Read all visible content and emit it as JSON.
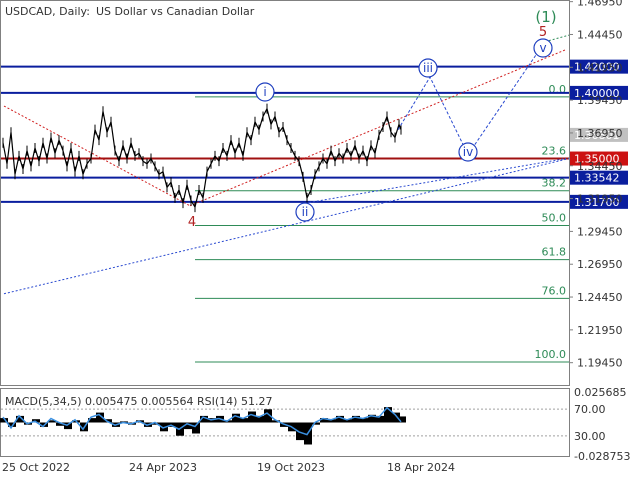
{
  "header": {
    "symbol": "USDCAD, Daily:",
    "description": "US Dollar vs Canadian Dollar"
  },
  "indicator_label": "MACD(5,34,5) 0.005475 0.005564 RSI(14) 51.27",
  "colors": {
    "price": "#000000",
    "support_resistance": "#0a1e9e",
    "pivot_line": "#a01010",
    "fib_line": "#2e8b57",
    "fib_text": "#2e8b57",
    "wave_circle": "#1f3fbf",
    "dotted_blue": "#2a4ad0",
    "dotted_red": "#d02020",
    "level_box_blue": "#0a1e9e",
    "level_box_red": "#cc1111",
    "current_box": "#c0c0c0",
    "rsi": "#3a8fe0",
    "macd": "#000000"
  },
  "chart_data": [
    {
      "type": "line",
      "title": "USDCAD, Daily: US Dollar vs Canadian Dollar",
      "x_ticks": [
        "25 Oct 2022",
        "24 Apr 2023",
        "19 Oct 2023",
        "18 Apr 2024"
      ],
      "y_ticks": [
        "1.46950",
        "1.44450",
        "1.41950",
        "1.39450",
        "1.36950",
        "1.34450",
        "1.31950",
        "1.29450",
        "1.26950",
        "1.24450",
        "1.21950",
        "1.19450"
      ],
      "ylim": [
        1.1775,
        1.47
      ],
      "price_path": [
        [
          0,
          1.362
        ],
        [
          4,
          1.346
        ],
        [
          8,
          1.37
        ],
        [
          12,
          1.338
        ],
        [
          16,
          1.352
        ],
        [
          20,
          1.342
        ],
        [
          24,
          1.356
        ],
        [
          28,
          1.344
        ],
        [
          32,
          1.358
        ],
        [
          36,
          1.348
        ],
        [
          40,
          1.362
        ],
        [
          44,
          1.35
        ],
        [
          48,
          1.366
        ],
        [
          52,
          1.354
        ],
        [
          56,
          1.364
        ],
        [
          60,
          1.356
        ],
        [
          64,
          1.344
        ],
        [
          68,
          1.358
        ],
        [
          72,
          1.34
        ],
        [
          76,
          1.352
        ],
        [
          80,
          1.338
        ],
        [
          84,
          1.346
        ],
        [
          88,
          1.35
        ],
        [
          92,
          1.372
        ],
        [
          96,
          1.364
        ],
        [
          100,
          1.386
        ],
        [
          104,
          1.37
        ],
        [
          108,
          1.378
        ],
        [
          112,
          1.356
        ],
        [
          116,
          1.348
        ],
        [
          120,
          1.36
        ],
        [
          124,
          1.35
        ],
        [
          128,
          1.362
        ],
        [
          132,
          1.352
        ],
        [
          136,
          1.354
        ],
        [
          140,
          1.348
        ],
        [
          144,
          1.346
        ],
        [
          148,
          1.35
        ],
        [
          152,
          1.344
        ],
        [
          156,
          1.338
        ],
        [
          160,
          1.34
        ],
        [
          164,
          1.328
        ],
        [
          168,
          1.332
        ],
        [
          172,
          1.32
        ],
        [
          176,
          1.326
        ],
        [
          180,
          1.316
        ],
        [
          184,
          1.33
        ],
        [
          188,
          1.318
        ],
        [
          192,
          1.313
        ],
        [
          196,
          1.326
        ],
        [
          200,
          1.32
        ],
        [
          204,
          1.34
        ],
        [
          208,
          1.346
        ],
        [
          212,
          1.352
        ],
        [
          216,
          1.348
        ],
        [
          220,
          1.358
        ],
        [
          224,
          1.352
        ],
        [
          228,
          1.364
        ],
        [
          232,
          1.354
        ],
        [
          236,
          1.362
        ],
        [
          240,
          1.352
        ],
        [
          244,
          1.37
        ],
        [
          248,
          1.364
        ],
        [
          252,
          1.378
        ],
        [
          256,
          1.372
        ],
        [
          260,
          1.382
        ],
        [
          264,
          1.388
        ],
        [
          268,
          1.376
        ],
        [
          272,
          1.382
        ],
        [
          276,
          1.37
        ],
        [
          280,
          1.374
        ],
        [
          284,
          1.364
        ],
        [
          288,
          1.358
        ],
        [
          292,
          1.352
        ],
        [
          296,
          1.348
        ],
        [
          300,
          1.336
        ],
        [
          304,
          1.32
        ],
        [
          308,
          1.326
        ],
        [
          312,
          1.338
        ],
        [
          316,
          1.344
        ],
        [
          320,
          1.35
        ],
        [
          324,
          1.346
        ],
        [
          328,
          1.356
        ],
        [
          332,
          1.348
        ],
        [
          336,
          1.354
        ],
        [
          340,
          1.35
        ],
        [
          344,
          1.358
        ],
        [
          348,
          1.352
        ],
        [
          352,
          1.36
        ],
        [
          356,
          1.35
        ],
        [
          360,
          1.356
        ],
        [
          364,
          1.348
        ],
        [
          368,
          1.36
        ],
        [
          372,
          1.354
        ],
        [
          376,
          1.368
        ],
        [
          380,
          1.374
        ],
        [
          384,
          1.382
        ],
        [
          388,
          1.37
        ],
        [
          392,
          1.366
        ],
        [
          396,
          1.376
        ],
        [
          398,
          1.372
        ]
      ],
      "support_resistance": [
        {
          "label": "1.42000",
          "value": 1.42,
          "color": "blue"
        },
        {
          "label": "1.40000",
          "value": 1.4,
          "color": "blue"
        },
        {
          "label": "1.35000",
          "value": 1.35,
          "color": "red"
        },
        {
          "label": "1.33542",
          "value": 1.33542,
          "color": "blue"
        },
        {
          "label": "1.31700",
          "value": 1.317,
          "color": "blue"
        }
      ],
      "current_price": {
        "label": "1.36801",
        "value": 1.36801
      },
      "fibonacci": [
        {
          "label": "0.0",
          "value": 1.397
        },
        {
          "label": "23.6",
          "value": 1.35
        },
        {
          "label": "38.2",
          "value": 1.3255
        },
        {
          "label": "50.0",
          "value": 1.299
        },
        {
          "label": "61.8",
          "value": 1.273
        },
        {
          "label": "76.0",
          "value": 1.2435
        },
        {
          "label": "100.0",
          "value": 1.195
        }
      ],
      "wave_labels": [
        {
          "label": "i",
          "style": "circle"
        },
        {
          "label": "ii",
          "style": "circle"
        },
        {
          "label": "iii",
          "style": "circle"
        },
        {
          "label": "iv",
          "style": "circle"
        },
        {
          "label": "v",
          "style": "circle"
        },
        {
          "label": "4",
          "style": "plain-red"
        },
        {
          "label": "5",
          "style": "plain-red"
        },
        {
          "label": "(1)",
          "style": "plain-green"
        }
      ],
      "projected_path": [
        {
          "point": "iii",
          "value": 1.42
        },
        {
          "point": "iv",
          "value": 1.353
        },
        {
          "point": "v",
          "value": 1.439
        }
      ]
    },
    {
      "type": "line",
      "title": "MACD(5,34,5) 0.005475 0.005564 RSI(14) 51.27",
      "y_ticks": [
        "0.025685",
        "70.00",
        "30.00",
        "-0.028753"
      ],
      "rsi_levels": [
        70,
        30
      ],
      "rsi_path": [
        [
          0,
          58
        ],
        [
          8,
          42
        ],
        [
          16,
          60
        ],
        [
          24,
          48
        ],
        [
          32,
          52
        ],
        [
          40,
          44
        ],
        [
          48,
          56
        ],
        [
          56,
          50
        ],
        [
          64,
          46
        ],
        [
          72,
          54
        ],
        [
          80,
          40
        ],
        [
          88,
          58
        ],
        [
          96,
          62
        ],
        [
          104,
          52
        ],
        [
          112,
          46
        ],
        [
          120,
          50
        ],
        [
          128,
          48
        ],
        [
          136,
          52
        ],
        [
          144,
          46
        ],
        [
          152,
          50
        ],
        [
          160,
          42
        ],
        [
          168,
          46
        ],
        [
          176,
          40
        ],
        [
          184,
          48
        ],
        [
          192,
          44
        ],
        [
          200,
          58
        ],
        [
          208,
          54
        ],
        [
          216,
          56
        ],
        [
          224,
          52
        ],
        [
          232,
          60
        ],
        [
          240,
          56
        ],
        [
          248,
          62
        ],
        [
          256,
          58
        ],
        [
          264,
          64
        ],
        [
          272,
          54
        ],
        [
          280,
          48
        ],
        [
          288,
          44
        ],
        [
          296,
          36
        ],
        [
          304,
          32
        ],
        [
          312,
          50
        ],
        [
          320,
          56
        ],
        [
          328,
          54
        ],
        [
          336,
          58
        ],
        [
          344,
          54
        ],
        [
          352,
          58
        ],
        [
          360,
          56
        ],
        [
          368,
          60
        ],
        [
          376,
          58
        ],
        [
          384,
          72
        ],
        [
          392,
          62
        ],
        [
          398,
          51
        ]
      ],
      "macd_hist": [
        [
          0,
          0.004
        ],
        [
          8,
          -0.004
        ],
        [
          16,
          0.006
        ],
        [
          24,
          -0.002
        ],
        [
          32,
          0.003
        ],
        [
          40,
          -0.004
        ],
        [
          48,
          0.002
        ],
        [
          56,
          -0.003
        ],
        [
          64,
          -0.006
        ],
        [
          72,
          0.002
        ],
        [
          80,
          -0.008
        ],
        [
          88,
          0.004
        ],
        [
          96,
          0.009
        ],
        [
          104,
          0.003
        ],
        [
          112,
          -0.004
        ],
        [
          120,
          0.001
        ],
        [
          128,
          -0.002
        ],
        [
          136,
          0.002
        ],
        [
          144,
          -0.004
        ],
        [
          152,
          -0.002
        ],
        [
          160,
          -0.008
        ],
        [
          168,
          -0.004
        ],
        [
          176,
          -0.012
        ],
        [
          184,
          -0.006
        ],
        [
          192,
          -0.01
        ],
        [
          200,
          0.006
        ],
        [
          208,
          0.004
        ],
        [
          216,
          0.006
        ],
        [
          224,
          0.002
        ],
        [
          232,
          0.008
        ],
        [
          240,
          0.004
        ],
        [
          248,
          0.01
        ],
        [
          256,
          0.006
        ],
        [
          264,
          0.012
        ],
        [
          272,
          0.002
        ],
        [
          280,
          -0.004
        ],
        [
          288,
          -0.008
        ],
        [
          296,
          -0.016
        ],
        [
          304,
          -0.02
        ],
        [
          312,
          -0.002
        ],
        [
          320,
          0.004
        ],
        [
          328,
          0.003
        ],
        [
          336,
          0.006
        ],
        [
          344,
          0.003
        ],
        [
          352,
          0.006
        ],
        [
          360,
          0.004
        ],
        [
          368,
          0.007
        ],
        [
          376,
          0.006
        ],
        [
          384,
          0.014
        ],
        [
          392,
          0.009
        ],
        [
          398,
          0.0055
        ]
      ]
    }
  ]
}
